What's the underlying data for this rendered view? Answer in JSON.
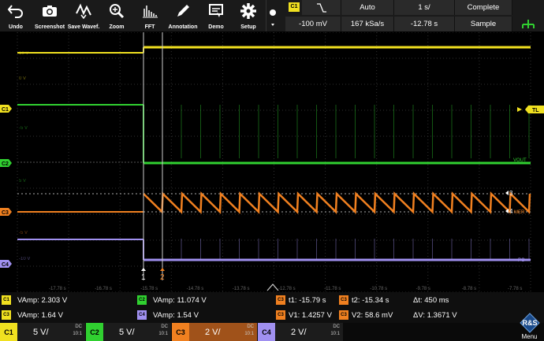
{
  "toolbar": {
    "buttons": [
      {
        "label": "Undo",
        "icon": "undo-icon"
      },
      {
        "label": "Screenshot",
        "icon": "camera-icon"
      },
      {
        "label": "Save Wavef.",
        "icon": "save-waveform-icon"
      },
      {
        "label": "Zoom",
        "icon": "zoom-icon"
      },
      {
        "label": "FFT",
        "icon": "fft-icon"
      },
      {
        "label": "Annotation",
        "icon": "pen-icon"
      },
      {
        "label": "Demo",
        "icon": "demo-icon"
      },
      {
        "label": "Setup",
        "icon": "gear-icon"
      }
    ],
    "trigger_source": "C1",
    "trigger_mode": "Auto",
    "timebase": "1 s/",
    "acq_state": "Complete",
    "trigger_level": "-100 mV",
    "sample_rate": "167 kSa/s",
    "trigger_position": "-12.78 s",
    "acq_mode": "Sample"
  },
  "grid": {
    "time_labels": [
      "-17.78 s",
      "-16.78 s",
      "-15.78 s",
      "-14.78 s",
      "-13.78 s",
      "-12.78 s",
      "-11.78 s",
      "-10.78 s",
      "-9.78 s",
      "-8.78 s",
      "-7.78 s"
    ],
    "left_markers": [
      "C1",
      "C2",
      "C3",
      "C4"
    ],
    "volt_labels": [
      "10 V",
      "0 V",
      "-5 V",
      "5 V",
      "-5 V",
      "-10 V"
    ],
    "right_labels": {
      "tl": "TL",
      "vout": "VOUT",
      "mer": "MER",
      "pg": "PG"
    },
    "cursor_labels": [
      "1",
      "2"
    ],
    "cursor_right_labels": [
      "3",
      "4"
    ]
  },
  "measurements": {
    "row1": [
      {
        "ch": "C1",
        "text": "VAmp: 2.303 V",
        "color": "#f0e020"
      },
      {
        "ch": "C2",
        "text": "VAmp: 11.074 V",
        "color": "#30d030"
      },
      {
        "ch": "C3",
        "text": "t1: -15.79 s",
        "color": "#f08020"
      },
      {
        "ch": "C3",
        "text": "t2: -15.34 s",
        "color": "#f08020"
      },
      {
        "ch": "",
        "text": "Δt: 450 ms",
        "color": ""
      }
    ],
    "row2": [
      {
        "ch": "C3",
        "text": "VAmp: 1.64 V",
        "color": "#f08020"
      },
      {
        "ch": "C4",
        "text": "VAmp: 1.54 V",
        "color": "#a090f0"
      },
      {
        "ch": "C3",
        "text": "V1: 1.4257 V",
        "color": "#f08020"
      },
      {
        "ch": "C3",
        "text": "V2: 58.6 mV",
        "color": "#f08020"
      },
      {
        "ch": "",
        "text": "ΔV: 1.3671 V",
        "color": ""
      }
    ]
  },
  "channels": [
    {
      "tag": "C1",
      "value": "5 V/",
      "coupling": "DC",
      "ratio": "10:1",
      "color": "#f0e020"
    },
    {
      "tag": "C2",
      "value": "5 V/",
      "coupling": "DC",
      "ratio": "10:1",
      "color": "#30d030"
    },
    {
      "tag": "C3",
      "value": "2 V/",
      "coupling": "DC",
      "ratio": "10:1",
      "color": "#f08020"
    },
    {
      "tag": "C4",
      "value": "2 V/",
      "coupling": "DC",
      "ratio": "10:1",
      "color": "#a090f0"
    }
  ],
  "menu": {
    "label": "Menu",
    "logo": "RS"
  }
}
